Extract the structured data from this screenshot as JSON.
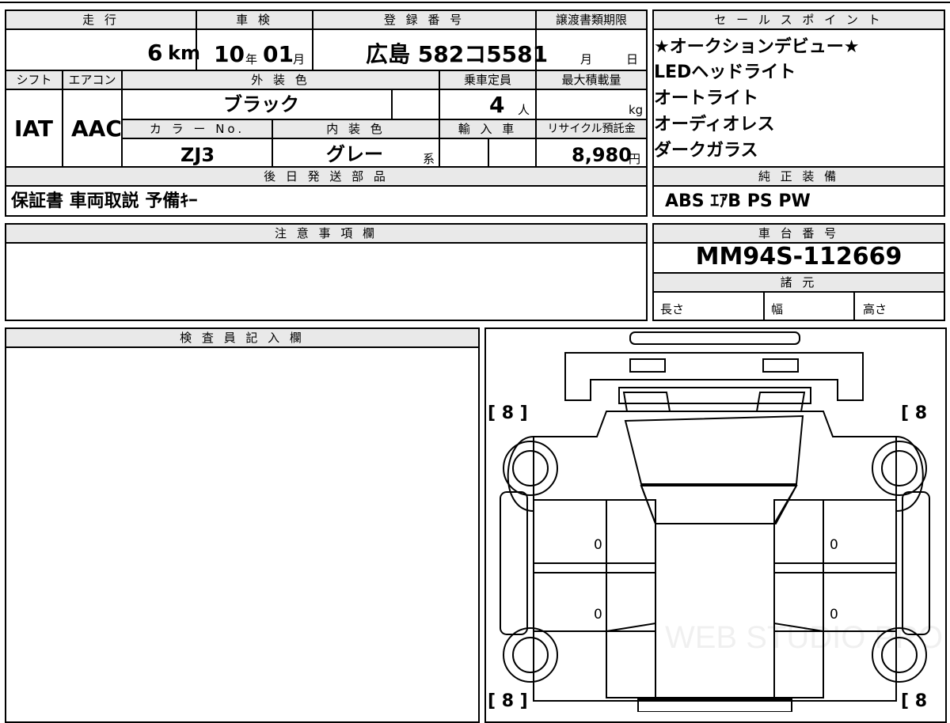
{
  "top": {
    "mileage": {
      "header": "走 行",
      "value": "6",
      "unit": "km"
    },
    "inspection": {
      "header": "車 検",
      "year": "10",
      "year_unit": "年",
      "month": "01",
      "month_unit": "月"
    },
    "registration": {
      "header": "登 録 番 号",
      "value": "広島 582コ5581"
    },
    "transfer_deadline": {
      "header": "譲渡書類期限",
      "month_unit": "月",
      "day_unit": "日"
    },
    "shift": {
      "header": "シフト",
      "value": "IAT"
    },
    "aircon": {
      "header": "エアコン",
      "value": "AAC"
    },
    "exterior_color": {
      "header": "外 装 色",
      "value": "ブラック"
    },
    "capacity": {
      "header": "乗車定員",
      "value": "4",
      "unit": "人"
    },
    "max_load": {
      "header": "最大積載量",
      "unit": "kg"
    },
    "color_no": {
      "header": "カ ラ ー No.",
      "value": "ZJ3"
    },
    "interior_color": {
      "header": "内 装 色",
      "value": "グレー",
      "suffix": "系"
    },
    "import": {
      "header": "輸 入 車"
    },
    "recycle": {
      "header": "リサイクル預託金",
      "value": "8,980",
      "unit": "円"
    },
    "shipping_parts": {
      "header": "後 日 発 送 部 品",
      "value": "保証書  車両取説  予備ｷｰ"
    }
  },
  "sales_points": {
    "header": "セ ー ル ス ポ イ ン ト",
    "items": [
      "★オークションデビュー★",
      "LEDヘッドライト",
      "オートライト",
      "オーディオレス",
      "ダークガラス"
    ]
  },
  "genuine_equipment": {
    "header": "純 正 装 備",
    "value": "ABS  ｴｱB  PS  PW"
  },
  "notes": {
    "header": "注 意 事 項 欄"
  },
  "chassis": {
    "header": "車 台 番 号",
    "value": "MM94S-112669"
  },
  "specs": {
    "header": "諸 元",
    "length": "長さ",
    "width": "幅",
    "height": "高さ"
  },
  "inspector": {
    "header": "検 査 員 記 入 欄"
  },
  "diagram": {
    "tire_tread": [
      "[ 8 ]",
      "[ 8",
      "[ 8 ]",
      "[ 8"
    ],
    "door_marks": [
      "0",
      "0",
      "0",
      "0"
    ],
    "watermark": "WEB STUDIO PRO"
  }
}
